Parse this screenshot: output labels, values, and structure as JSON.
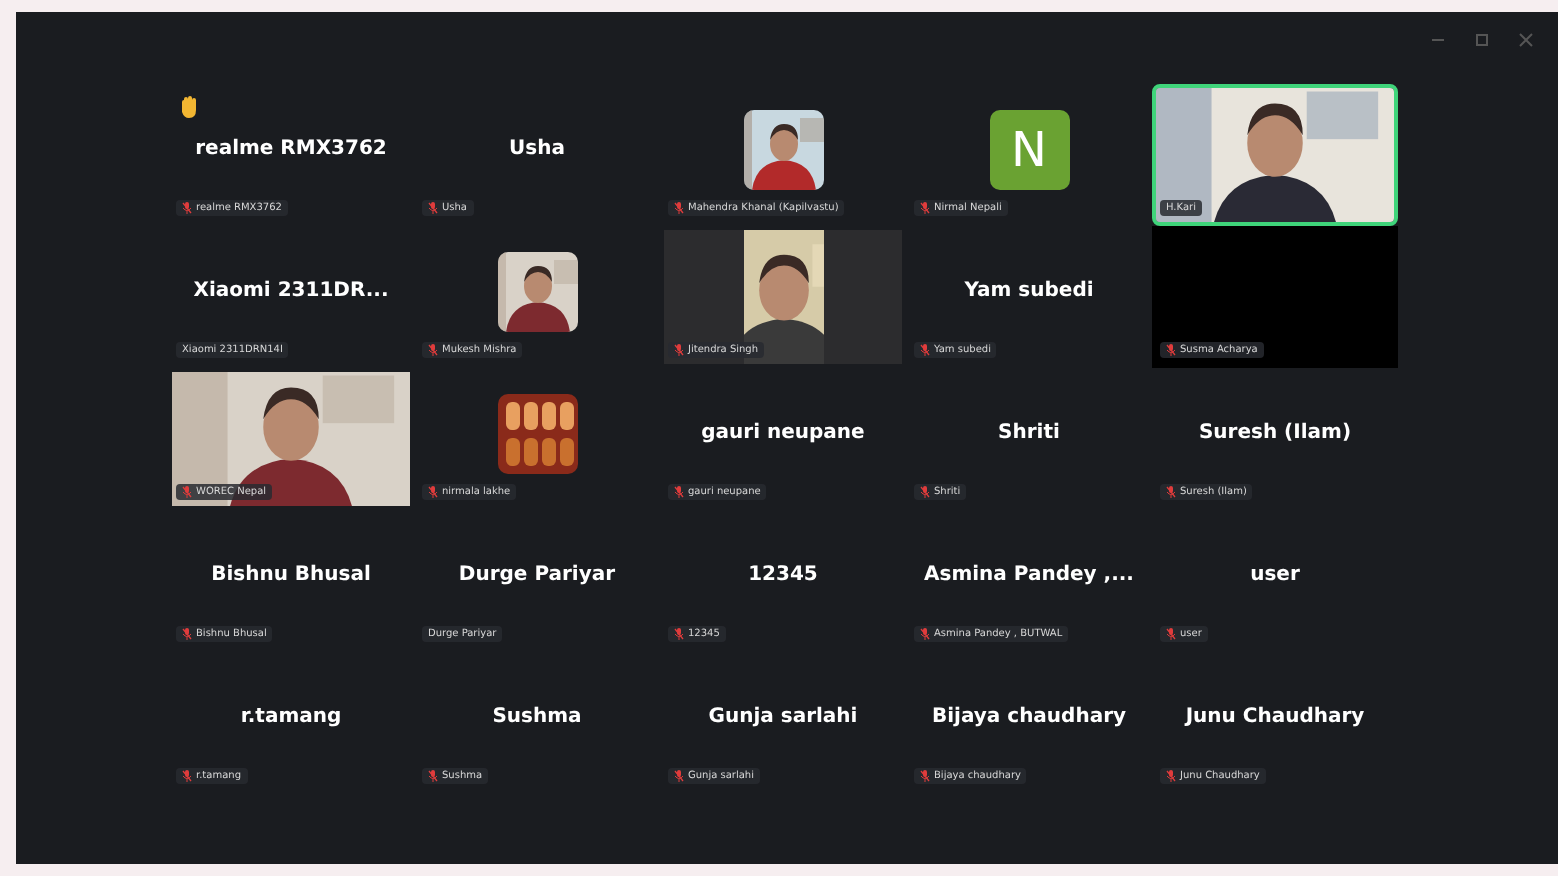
{
  "tiles": [
    {
      "kind": "name",
      "name": "realme RMX3762",
      "label": "realme RMX3762",
      "muted": true,
      "hand_raised": true,
      "speaking": false
    },
    {
      "kind": "name",
      "name": "Usha",
      "label": "Usha",
      "muted": true,
      "hand_raised": false,
      "speaking": false
    },
    {
      "kind": "avatar",
      "label": "Mahendra Khanal (Kapilvastu)",
      "muted": true,
      "hand_raised": false,
      "speaking": false
    },
    {
      "kind": "letter",
      "letter": "N",
      "color": "#6aa232",
      "label": "Nirmal Nepali",
      "muted": true,
      "hand_raised": false,
      "speaking": false
    },
    {
      "kind": "video",
      "label": "H.Kari",
      "muted": false,
      "hand_raised": false,
      "speaking": true
    },
    {
      "kind": "name",
      "name": "Xiaomi  2311DR...",
      "label": "Xiaomi 2311DRN14I",
      "muted": false,
      "hand_raised": false,
      "speaking": false
    },
    {
      "kind": "avatar",
      "label": "Mukesh Mishra",
      "muted": true,
      "hand_raised": false,
      "speaking": false
    },
    {
      "kind": "video_narrow",
      "label": "Jitendra Singh",
      "muted": true,
      "hand_raised": false,
      "speaking": false
    },
    {
      "kind": "name",
      "name": "Yam subedi",
      "label": "Yam subedi",
      "muted": true,
      "hand_raised": false,
      "speaking": false
    },
    {
      "kind": "blank",
      "label": "Susma Acharya",
      "muted": true,
      "hand_raised": false,
      "speaking": false
    },
    {
      "kind": "video",
      "label": "WOREC Nepal",
      "muted": true,
      "hand_raised": false,
      "speaking": false
    },
    {
      "kind": "avatar",
      "label": "nirmala lakhe",
      "muted": true,
      "hand_raised": false,
      "speaking": false
    },
    {
      "kind": "name",
      "name": "gauri neupane",
      "label": "gauri neupane",
      "muted": true,
      "hand_raised": false,
      "speaking": false
    },
    {
      "kind": "name",
      "name": "Shriti",
      "label": "Shriti",
      "muted": true,
      "hand_raised": false,
      "speaking": false
    },
    {
      "kind": "name",
      "name": "Suresh (Ilam)",
      "label": "Suresh (Ilam)",
      "muted": true,
      "hand_raised": false,
      "speaking": false
    },
    {
      "kind": "name",
      "name": "Bishnu Bhusal",
      "label": "Bishnu Bhusal",
      "muted": true,
      "hand_raised": false,
      "speaking": false
    },
    {
      "kind": "name",
      "name": "Durge Pariyar",
      "label": "Durge Pariyar",
      "muted": false,
      "hand_raised": false,
      "speaking": false
    },
    {
      "kind": "name",
      "name": "12345",
      "label": "12345",
      "muted": true,
      "hand_raised": false,
      "speaking": false
    },
    {
      "kind": "name",
      "name": "Asmina  Pandey ,...",
      "label": "Asmina Pandey , BUTWAL",
      "muted": true,
      "hand_raised": false,
      "speaking": false
    },
    {
      "kind": "name",
      "name": "user",
      "label": "user",
      "muted": true,
      "hand_raised": false,
      "speaking": false
    },
    {
      "kind": "name",
      "name": "r.tamang",
      "label": "r.tamang",
      "muted": true,
      "hand_raised": false,
      "speaking": false
    },
    {
      "kind": "name",
      "name": "Sushma",
      "label": "Sushma",
      "muted": true,
      "hand_raised": false,
      "speaking": false
    },
    {
      "kind": "name",
      "name": "Gunja sarlahi",
      "label": "Gunja sarlahi",
      "muted": true,
      "hand_raised": false,
      "speaking": false
    },
    {
      "kind": "name",
      "name": "Bijaya chaudhary",
      "label": "Bijaya chaudhary",
      "muted": true,
      "hand_raised": false,
      "speaking": false
    },
    {
      "kind": "name",
      "name": "Junu Chaudhary",
      "label": "Junu Chaudhary",
      "muted": true,
      "hand_raised": false,
      "speaking": false
    }
  ]
}
